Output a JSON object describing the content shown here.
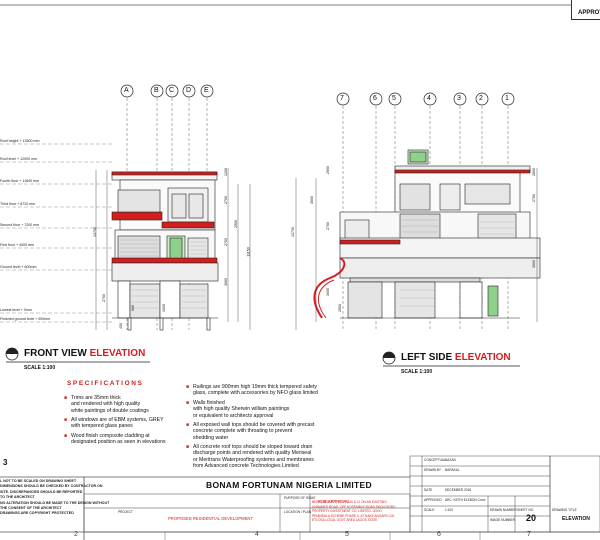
{
  "header": {
    "approval_label": "APPROV"
  },
  "front_view": {
    "title_black": "FRONT VIEW",
    "title_red": "ELEVATION",
    "scale": "SCALE 1:100",
    "grid_labels": [
      "A",
      "B",
      "C",
      "D",
      "E"
    ],
    "level_labels": [
      "Roof height + 13500 mm",
      "Roof level + 12000 mm",
      "Fourth floor + 11600 mm",
      "Third floor + 8720 mm",
      "Second floor + 7200 mm",
      "First floor + 4000 mm",
      "Ground level + 600mm",
      "Lowest level + 0mm",
      "Finished ground level + 000mm"
    ],
    "dims": [
      "1200",
      "2700",
      "13730",
      "11150",
      "2700",
      "3000",
      "900",
      "1000",
      "2500",
      "2700",
      "450"
    ]
  },
  "side_view": {
    "title_black": "LEFT SIDE",
    "title_red": "ELEVATION",
    "scale": "SCALE 1:100",
    "grid_labels": [
      "7",
      "6",
      "5",
      "4",
      "3",
      "2",
      "1"
    ],
    "dims": [
      "2900",
      "3600",
      "2700",
      "13730",
      "2700",
      "3000",
      "3000",
      "2500",
      "2800"
    ]
  },
  "specifications": {
    "title": "SPECIFICATIONS",
    "left": [
      "Trims are 35mm thick\nand rendered with high quality\nwhite paintings of double coatings",
      "All windows are of EBM systems, GREY\nwith tempered glass panes",
      "Wood finish composite cladding at\ndesignated position as seen in elevations"
    ],
    "right": [
      "Railings are 900mm high 19mm thick tempered safety\nglass, complete with accessories by NFO glass limited",
      "Walls finished\nwith high quality Sherwin william paintings\nor equivalent to architects approval",
      "All exposed wall tops should be covered with precast\nconcrete complete with throating to prevent\nshedding water",
      "All concrete roof tops should be sloped toward drain\ndischarge points and rendered with quality Meriseal\nor Meritrans Waterproofing systems and membranes\nfrom Advanced concrete Technologies Limited"
    ]
  },
  "sheet_number_mark": "3",
  "notes": "L NOT TO BE SCALED ON DRAWING SHEET\nDIMENSIONS SHOULD BE CHECKED BY CONTRACTOR ON\nSITE. DISCREPANCIES SHOULD BE REPORTED\nTO THE ARCHITECT\nNO ALTERATION SHOULD BE MADE TO THE DESIGN WITHOUT\nTHE CONSENT OF THE ARCHITECT\nDRAWINGS ARE COPYRIGHT PROTECTED",
  "title_block": {
    "company": "BONAM FORTUNAM NIGERIA LIMITED",
    "purpose_label": "PURPOSE OF ISSUE",
    "purpose_value": "FOR APPROVAL",
    "project_label": "PROJECT",
    "project_value": "PROPOSED RESIDENTIAL DEVELOPMENT",
    "location_label": "LOCATION / PLAN",
    "location_value": "BEING BLOCK 1, PLOTS 10 & 11 ON AN EXISTING\nUNNAMED ROAD, OFF KOSEMBLE ROAD SHOLE/IGBO\nPROPERTY INVESTMENT CO. LIMITED. LEKKI\nPENINSULA SCHEME PHASE II. AT NAKE ANGARI LGA\nETI-OSA LOCAL GOVT AREA LAGOS STATE.",
    "sheet_number": "20",
    "drawing_title": "ELEVATION",
    "right_fields": [
      {
        "label": "CONCEPTUAL",
        "value": "NAZAN"
      },
      {
        "label": "DRAWN BY",
        "value": "BARAKAL"
      },
      {
        "label": "DATE",
        "value": "DECEMBER 2018"
      },
      {
        "label": "APPROVED",
        "value": "ARC. KEITH ELEBON Crum"
      },
      {
        "label": "SCALE",
        "value": "1:100"
      }
    ],
    "mid_labels": [
      "DRAWN NUMBER",
      "SHEET NO.",
      "DRAWING TITLE",
      "IMAGE NUMBER"
    ]
  },
  "column_markers": [
    "2",
    "4",
    "5",
    "6",
    "7"
  ]
}
